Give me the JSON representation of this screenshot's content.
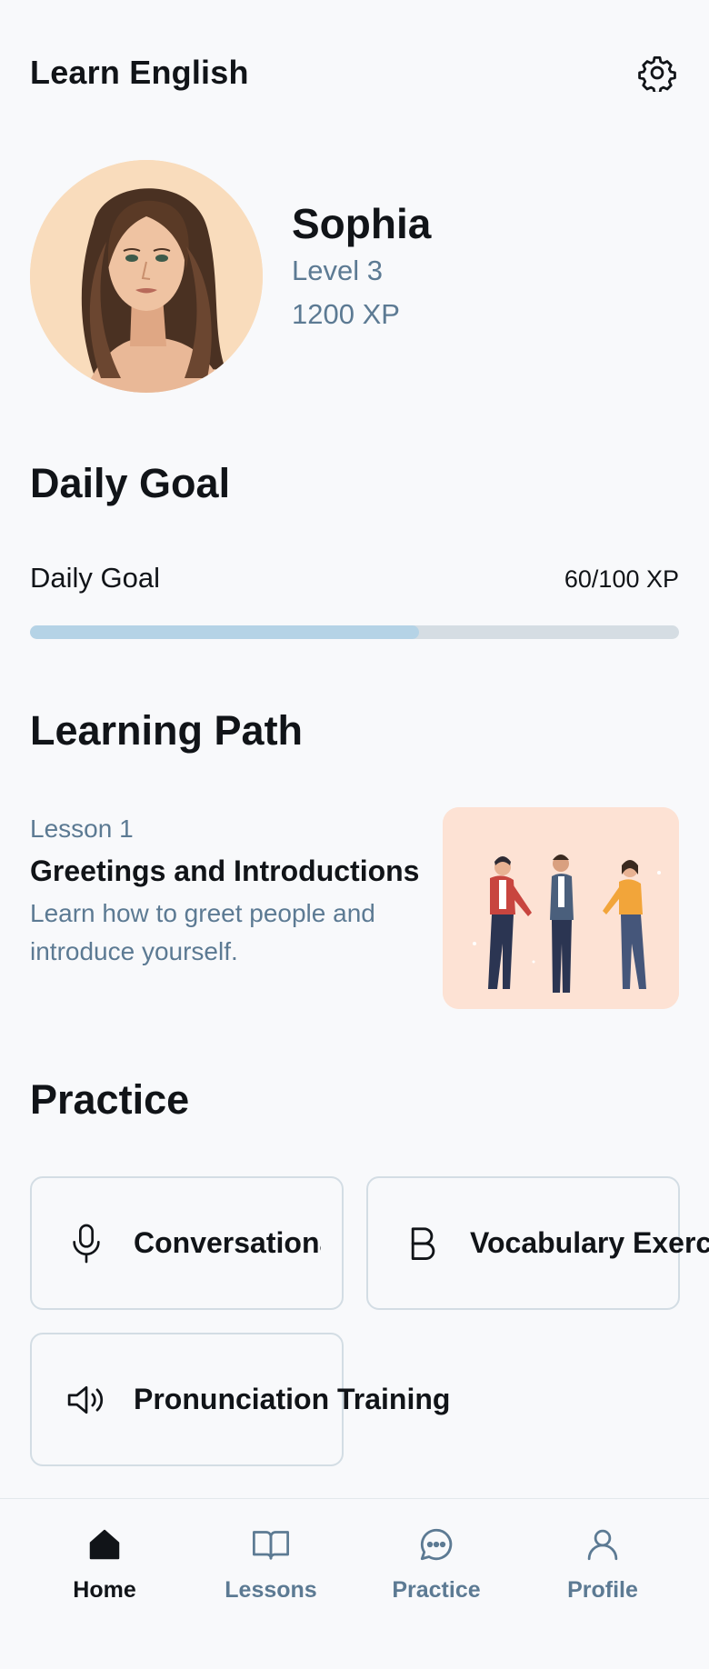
{
  "header": {
    "title": "Learn English",
    "settings_icon": "gear-icon"
  },
  "profile": {
    "name": "Sophia",
    "level": "Level 3",
    "xp": "1200 XP"
  },
  "daily_goal": {
    "section_title": "Daily Goal",
    "label": "Daily Goal",
    "value_text": "60/100 XP",
    "progress_fraction": 0.6
  },
  "learning_path": {
    "section_title": "Learning Path",
    "lesson": {
      "number": "Lesson 1",
      "title": "Greetings and Introductions",
      "description": "Learn how to greet people and introduce yourself."
    }
  },
  "practice": {
    "section_title": "Practice",
    "cards": [
      {
        "label": "Conversational Practice",
        "icon": "microphone-icon"
      },
      {
        "label": "Vocabulary Exercises",
        "icon": "bold-b-icon"
      },
      {
        "label": "Pronunciation Training",
        "icon": "speaker-icon"
      }
    ]
  },
  "bottom_nav": {
    "items": [
      {
        "label": "Home",
        "icon": "home-icon",
        "active": true
      },
      {
        "label": "Lessons",
        "icon": "book-icon",
        "active": false
      },
      {
        "label": "Practice",
        "icon": "chat-bubble-icon",
        "active": false
      },
      {
        "label": "Profile",
        "icon": "user-icon",
        "active": false
      }
    ]
  },
  "colors": {
    "background": "#f8f9fb",
    "muted_text": "#5c7a93",
    "progress_fill": "#b5d3e6",
    "progress_track": "#d5dde3",
    "card_border": "#d3dde4",
    "avatar_bg": "#f9dcbc",
    "lesson_image_bg": "#fde2d4"
  }
}
